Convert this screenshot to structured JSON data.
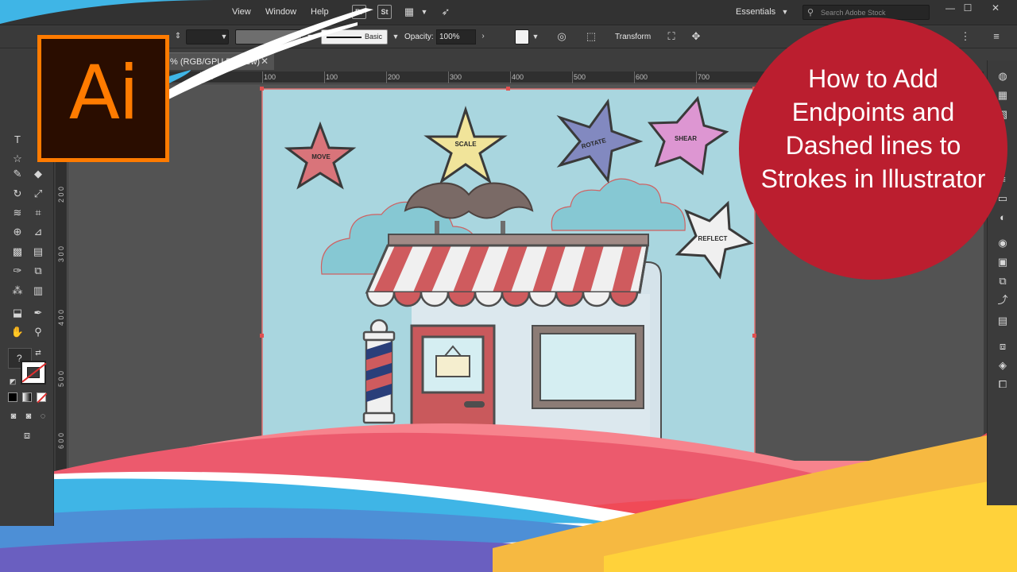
{
  "menu": {
    "items": [
      "View",
      "Window",
      "Help"
    ]
  },
  "app_buttons": [
    "Br",
    "St"
  ],
  "workspace": {
    "label": "Essentials"
  },
  "search": {
    "placeholder": "Search Adobe Stock"
  },
  "control_bar": {
    "stroke_profile": "Basic",
    "opacity_label": "Opacity:",
    "opacity_value": "100%",
    "transform_label": "Transform"
  },
  "document_tab": {
    "title": "% (RGB/GPU Preview)"
  },
  "ruler": {
    "h_ticks": [
      "100",
      "100",
      "200",
      "300",
      "400",
      "500",
      "600",
      "700"
    ],
    "v_ticks": [
      "2 0 0",
      "3 0 0",
      "4 0 0",
      "5 0 0",
      "6 0 0"
    ]
  },
  "artwork": {
    "star_labels": [
      "MOVE",
      "SCALE",
      "ROTATE",
      "SHEAR",
      "REFLECT"
    ]
  },
  "tools": {
    "question_mark": "?"
  },
  "logo": {
    "text": "Ai"
  },
  "title_circle": {
    "text": "How to Add Endpoints and Dashed lines to Strokes in Illustrator"
  },
  "colors": {
    "logo_orange": "#ff7b00",
    "logo_bg": "#2a0d00",
    "title_red": "#bb1e2f",
    "artboard_bg": "#a9d6df",
    "awning_red": "#cf5b5e"
  }
}
